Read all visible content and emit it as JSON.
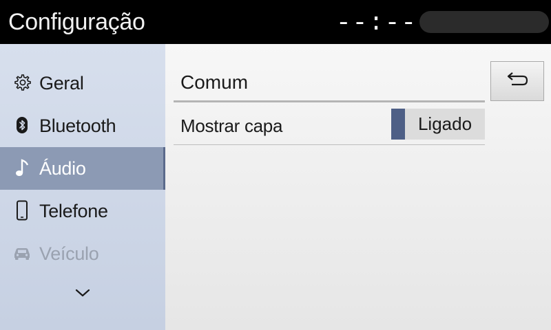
{
  "header": {
    "title": "Configuração",
    "clock": "--:--"
  },
  "sidebar": {
    "items": [
      {
        "label": "Geral",
        "icon": "gear-icon",
        "state": "normal"
      },
      {
        "label": "Bluetooth",
        "icon": "bluetooth-icon",
        "state": "normal"
      },
      {
        "label": "Áudio",
        "icon": "music-note-icon",
        "state": "selected"
      },
      {
        "label": "Telefone",
        "icon": "phone-icon",
        "state": "normal"
      },
      {
        "label": "Veículo",
        "icon": "car-icon",
        "state": "disabled"
      }
    ],
    "more_icon": "chevron-down-icon"
  },
  "main": {
    "section_header": "Comum",
    "settings": [
      {
        "label": "Mostrar capa",
        "value": "Ligado"
      }
    ],
    "back_icon": "back-arrow-icon"
  },
  "colors": {
    "accent": "#4e5f86",
    "selected_bg": "#8c9ab4",
    "header_bg": "#000000"
  }
}
